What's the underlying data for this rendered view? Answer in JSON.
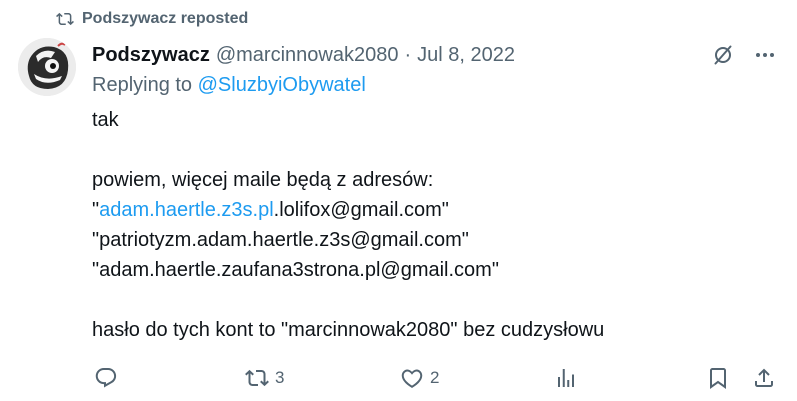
{
  "repost": {
    "label": "Podszywacz reposted",
    "icon": "repost-icon"
  },
  "tweet": {
    "display_name": "Podszywacz",
    "handle": "@marcinnowak2080",
    "separator": "·",
    "date": "Jul 8, 2022",
    "replying_prefix": "Replying to",
    "replying_to": "@SluzbyiObywatel",
    "body": {
      "line1": "tak",
      "line2": "powiem, więcej maile będą z adresów:",
      "line3_quote_open": "\"",
      "line3_link": "adam.haertle.z3s.pl",
      "line3_rest": ".lolifox@gmail.com\"",
      "line4": "\"patriotyzm.adam.haertle.z3s@gmail.com\"",
      "line5": "\"adam.haertle.zaufana3strona.pl@gmail.com\"",
      "line6": "hasło do tych kont to \"marcinnowak2080\" bez cudzysłowu"
    }
  },
  "actions": {
    "reply": {
      "icon": "reply-icon"
    },
    "repost": {
      "icon": "repost-icon",
      "count": "3"
    },
    "like": {
      "icon": "heart-icon",
      "count": "2"
    },
    "views": {
      "icon": "views-icon"
    },
    "bookmark": {
      "icon": "bookmark-icon"
    },
    "share": {
      "icon": "share-icon"
    }
  },
  "colors": {
    "accent": "#1d9bf0",
    "muted": "#536471",
    "text": "#0f1419"
  }
}
